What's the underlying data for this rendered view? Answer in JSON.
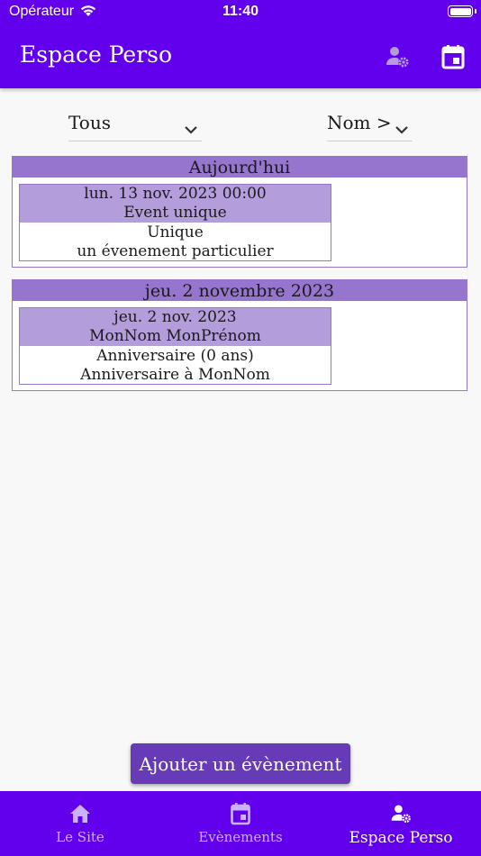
{
  "status": {
    "carrier": "Opérateur",
    "time": "11:40"
  },
  "appbar": {
    "title": "Espace Perso",
    "icons": [
      "user-settings-icon",
      "calendar-event-icon"
    ]
  },
  "filters": {
    "type": {
      "value": "Tous"
    },
    "sort": {
      "value": "Nom >"
    }
  },
  "groups": [
    {
      "header": "Aujourd'hui",
      "events": [
        {
          "date": "lun. 13 nov. 2023 00:00",
          "name": "Event unique",
          "type": "Unique",
          "description": "un évenement particulier"
        }
      ]
    },
    {
      "header": "jeu.  2 novembre 2023",
      "events": [
        {
          "date": "jeu.  2 nov. 2023",
          "name": "MonNom MonPrénom",
          "type": "Anniversaire (0 ans)",
          "description": "Anniversaire à MonNom"
        }
      ]
    }
  ],
  "add_button": {
    "label": "Ajouter un évènement"
  },
  "bottom_nav": {
    "items": [
      {
        "label": "Le Site",
        "icon": "home-icon",
        "active": false
      },
      {
        "label": "Evènements",
        "icon": "calendar-icon",
        "active": false
      },
      {
        "label": "Espace Perso",
        "icon": "user-settings-icon",
        "active": true
      }
    ]
  },
  "colors": {
    "primary": "#6200ee",
    "group_header": "#9575cd",
    "card_header": "#b39ddb",
    "button": "#673ab7"
  }
}
